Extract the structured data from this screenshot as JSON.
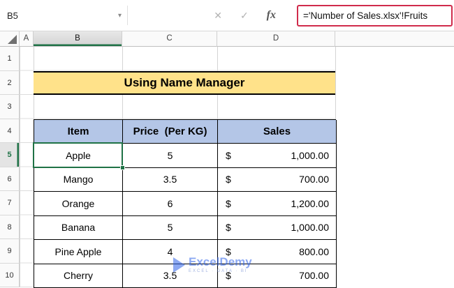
{
  "formula_bar": {
    "name_box": "B5",
    "name_box_caret": "▾",
    "cancel_label": "✕",
    "enter_label": "✓",
    "fx_label": "fx",
    "formula": "='Number of Sales.xlsx'!Fruits"
  },
  "grid": {
    "column_headers": [
      "A",
      "B",
      "C",
      "D"
    ],
    "row_headers": [
      "1",
      "2",
      "3",
      "4",
      "5",
      "6",
      "7",
      "8",
      "9",
      "10"
    ],
    "selected_cell": "B5"
  },
  "sheet": {
    "banner": "Using Name Manager",
    "table": {
      "headers": [
        "Item",
        "Price  (Per KG)",
        "Sales"
      ],
      "rows": [
        {
          "item": "Apple",
          "price": "5",
          "currency": "$",
          "sales": "1,000.00"
        },
        {
          "item": "Mango",
          "price": "3.5",
          "currency": "$",
          "sales": "700.00"
        },
        {
          "item": "Orange",
          "price": "6",
          "currency": "$",
          "sales": "1,200.00"
        },
        {
          "item": "Banana",
          "price": "5",
          "currency": "$",
          "sales": "1,000.00"
        },
        {
          "item": "Pine Apple",
          "price": "4",
          "currency": "$",
          "sales": "800.00"
        },
        {
          "item": "Cherry",
          "price": "3.5",
          "currency": "$",
          "sales": "700.00"
        }
      ]
    }
  },
  "watermark": {
    "brand": "ExcelDemy",
    "tagline": "EXCEL · DATA · BI"
  },
  "colors": {
    "banner_bg": "#FFE28A",
    "table_header_bg": "#B4C6E7",
    "selection_green": "#1F7246",
    "annotation_red": "#D02B4B",
    "watermark_blue": "#2E62E8"
  }
}
